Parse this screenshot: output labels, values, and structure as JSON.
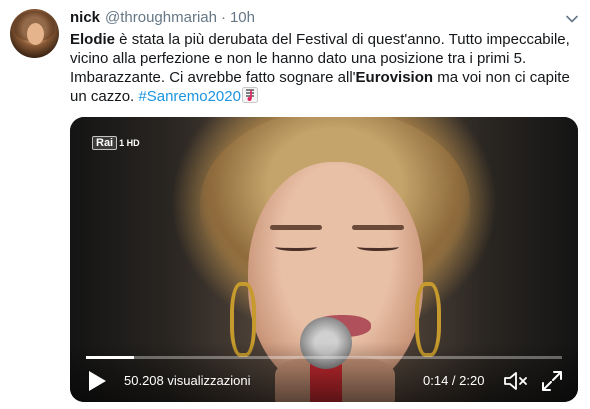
{
  "tweet": {
    "author_name": "nick",
    "handle": "@throughmariah",
    "separator": "·",
    "time": "10h",
    "text": {
      "elodie": "Elodie",
      "part1": " è stata la più derubata del Festival di quest'anno. Tutto impeccabile, vicino alla perfezione e non le hanno dato una posizione tra i primi 5. Imbarazzante. Ci avrebbe fatto sognare all'",
      "eurovision": "Eurovision",
      "part2": " ma voi non ci capite un cazzo. ",
      "hashtag": "#Sanremo2020",
      "emoji": "music-notes-emoji"
    }
  },
  "video": {
    "channel_logo": "Rai",
    "channel_number": "1 HD",
    "views": "50.208 visualizzazioni",
    "duration": "0:14 / 2:20",
    "progress": 0.1,
    "icons": {
      "play": "play-icon",
      "volume": "volume-muted-icon",
      "fullscreen": "fullscreen-icon"
    }
  },
  "colors": {
    "link": "#1b95e0",
    "text": "#14171a",
    "muted": "#657786"
  }
}
